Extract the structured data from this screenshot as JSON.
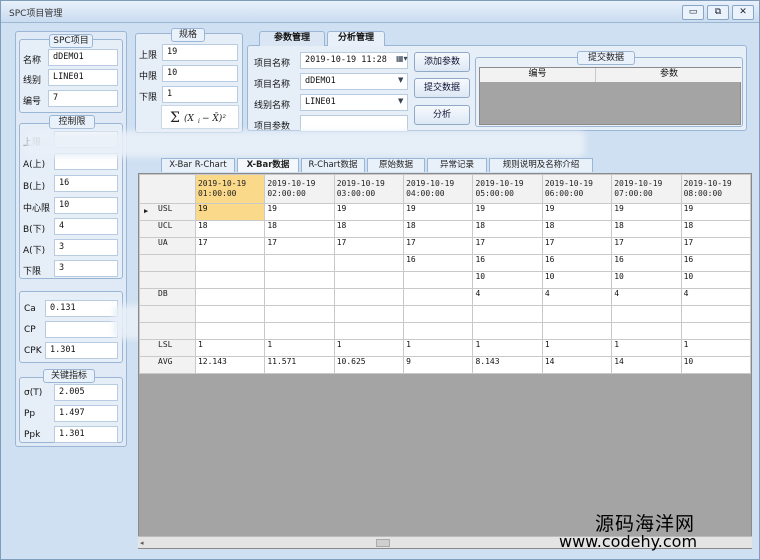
{
  "window": {
    "title": "SPC项目管理",
    "controls": [
      "▭",
      "⧉",
      "✕"
    ]
  },
  "spc_project": {
    "title": "SPC项目",
    "fields": [
      {
        "label": "名称",
        "value": "dDEMO1"
      },
      {
        "label": "线别",
        "value": "LINE01"
      },
      {
        "label": "编号",
        "value": "7"
      }
    ]
  },
  "control_limits": {
    "title": "控制限",
    "fields": [
      {
        "label": "上限",
        "value": ""
      },
      {
        "label": "A(上)",
        "value": ""
      },
      {
        "label": "B(上)",
        "value": "16"
      },
      {
        "label": "中心限",
        "value": "10"
      },
      {
        "label": "B(下)",
        "value": "4"
      },
      {
        "label": "A(下)",
        "value": "3"
      },
      {
        "label": "下限",
        "value": "3"
      }
    ]
  },
  "capability": {
    "fields": [
      {
        "label": "Ca",
        "value": "0.131"
      },
      {
        "label": "CP",
        "value": ""
      },
      {
        "label": "CPK",
        "value": "1.301"
      }
    ]
  },
  "key_indicators": {
    "title": "关键指标",
    "fields": [
      {
        "label": "σ(T)",
        "value": "2.005"
      },
      {
        "label": "Pp",
        "value": "1.497"
      },
      {
        "label": "Ppk",
        "value": "1.301"
      }
    ]
  },
  "spec": {
    "title": "规格",
    "fields": [
      {
        "label": "上限",
        "value": "19"
      },
      {
        "label": "中限",
        "value": "10"
      },
      {
        "label": "下限",
        "value": "1"
      }
    ]
  },
  "param_tabs": [
    {
      "label": "参数管理",
      "active": true
    },
    {
      "label": "分析管理",
      "active": false
    }
  ],
  "params": {
    "project_name_label": "项目名称",
    "project_name_value": "2019-10-19 11:28",
    "item_name_label": "项目名称",
    "item_name_value": "dDEMO1",
    "line_name_label": "线别名称",
    "line_name_value": "LINE01",
    "item_param_label": "项目参数",
    "item_param_value": ""
  },
  "buttons": {
    "add_param": "添加参数",
    "submit_data": "提交数据",
    "analyze": "分析"
  },
  "submit_panel": {
    "title": "提交数据",
    "columns": [
      "编号",
      "参数"
    ]
  },
  "sub_tabs": [
    {
      "label": "X-Bar R-Chart",
      "active": false
    },
    {
      "label": "X-Bar数据",
      "active": true
    },
    {
      "label": "R-Chart数据",
      "active": false
    },
    {
      "label": "原始数据",
      "active": false
    },
    {
      "label": "异常记录",
      "active": false
    },
    {
      "label": "规则说明及名称介绍",
      "active": false
    }
  ],
  "grid": {
    "columns": [
      "2019-10-19 01:00:00",
      "2019-10-19 02:00:00",
      "2019-10-19 03:00:00",
      "2019-10-19 04:00:00",
      "2019-10-19 05:00:00",
      "2019-10-19 06:00:00",
      "2019-10-19 07:00:00",
      "2019-10-19 08:00:00"
    ],
    "rows": [
      {
        "label": "USL",
        "cells": [
          "19",
          "19",
          "19",
          "19",
          "19",
          "19",
          "19",
          "19"
        ]
      },
      {
        "label": "UCL",
        "cells": [
          "18",
          "18",
          "18",
          "18",
          "18",
          "18",
          "18",
          "18"
        ]
      },
      {
        "label": "UA",
        "cells": [
          "17",
          "17",
          "17",
          "17",
          "17",
          "17",
          "17",
          "17"
        ]
      },
      {
        "label": "",
        "cells": [
          "",
          "",
          "",
          "16",
          "16",
          "16",
          "16",
          "16"
        ]
      },
      {
        "label": "",
        "cells": [
          "",
          "",
          "",
          "",
          "10",
          "10",
          "10",
          "10"
        ]
      },
      {
        "label": "DB",
        "cells": [
          "",
          "",
          "",
          "",
          "4",
          "4",
          "4",
          "4"
        ]
      },
      {
        "label": "",
        "cells": [
          "",
          "",
          "",
          "",
          "",
          "",
          "",
          ""
        ]
      },
      {
        "label": "",
        "cells": [
          "",
          "",
          "",
          "",
          "",
          "",
          "",
          ""
        ]
      },
      {
        "label": "LSL",
        "cells": [
          "1",
          "1",
          "1",
          "1",
          "1",
          "1",
          "1",
          "1"
        ]
      },
      {
        "label": "AVG",
        "cells": [
          "12.143",
          "11.571",
          "10.625",
          "9",
          "8.143",
          "14",
          "14",
          "10"
        ]
      }
    ]
  },
  "watermark": {
    "line1": "源码海洋网",
    "line2": "www.codehy.com"
  }
}
